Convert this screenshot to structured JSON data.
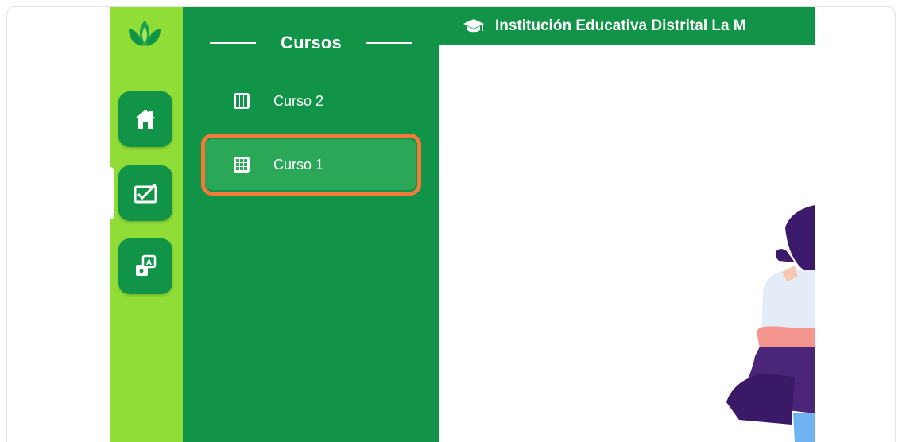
{
  "header": {
    "title": "Institución Educativa Distrital La M"
  },
  "icons": {
    "logo": "lotus-logo-icon",
    "home": "home-icon",
    "chart": "chart-icon",
    "translate": "translate-icon",
    "course": "grid-icon",
    "header": "graduation-cap-icon"
  },
  "panel": {
    "title": "Cursos",
    "courses": [
      {
        "label": "Curso 2",
        "active": false
      },
      {
        "label": "Curso 1",
        "active": true
      }
    ]
  },
  "colors": {
    "rail": "#8fdd36",
    "panel": "#119447",
    "active_item": "#2aa857",
    "highlight": "#f47a3a"
  }
}
